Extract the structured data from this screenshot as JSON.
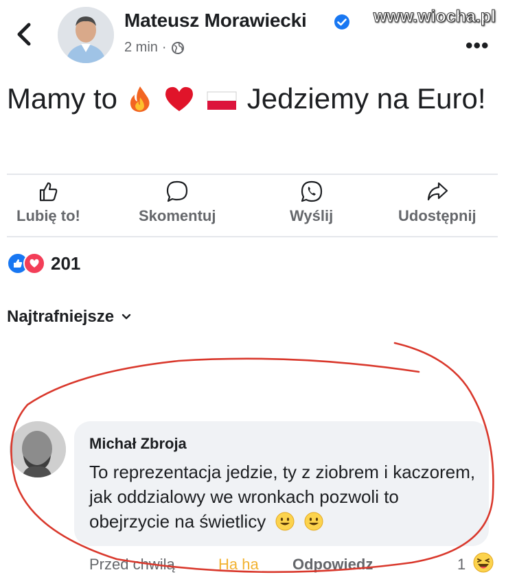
{
  "header": {
    "author": "Mateusz Morawiecki",
    "time": "2 min",
    "separator": "·",
    "watermark": "www.wiocha.pl"
  },
  "post": {
    "text_part1": "Mamy to",
    "text_part2": "Jedziemy na Euro!"
  },
  "actions": [
    {
      "label": "Lubię to!",
      "icon": "thumbs-up-icon"
    },
    {
      "label": "Skomentuj",
      "icon": "comment-icon"
    },
    {
      "label": "Wyślij",
      "icon": "whatsapp-icon"
    },
    {
      "label": "Udostępnij",
      "icon": "share-icon"
    }
  ],
  "reactions": {
    "count": "201"
  },
  "sort": {
    "label": "Najtrafniejsze"
  },
  "comment": {
    "author": "Michał Zbroja",
    "text": "To reprezentacja jedzie, ty z ziobrem i kaczorem, jak oddzialowy we wronkach pozwoli to obejrzycie na świetlicy",
    "time": "Przed chwilą",
    "reaction_action": "Ha ha",
    "reply_action": "Odpowiedz",
    "reaction_count": "1"
  },
  "colors": {
    "facebook_blue": "#1877f2",
    "love_red": "#f33e58",
    "annotation_red": "#d9382c"
  }
}
